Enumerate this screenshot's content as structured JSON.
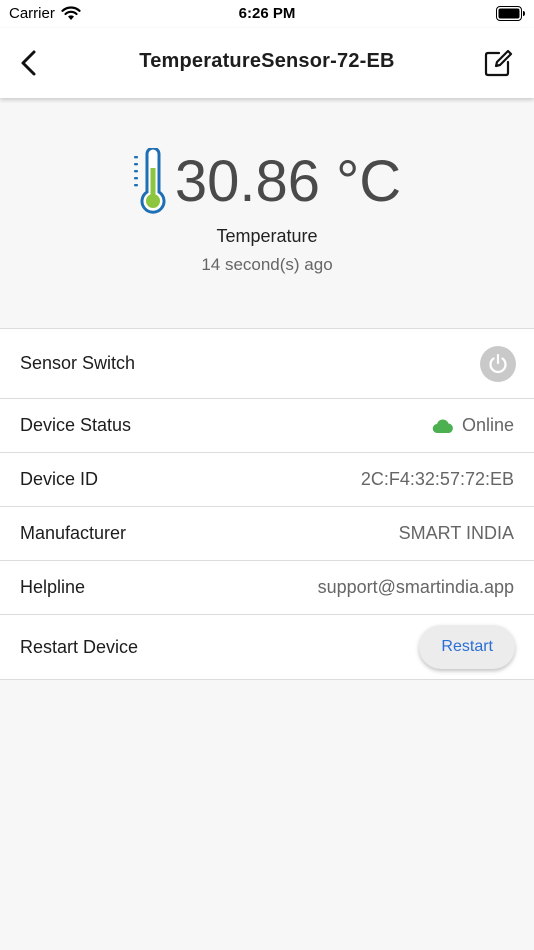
{
  "status_bar": {
    "carrier": "Carrier",
    "time": "6:26 PM"
  },
  "nav": {
    "title": "TemperatureSensor-72-EB",
    "back_icon": "chevron-left-icon",
    "edit_icon": "edit-icon"
  },
  "reading": {
    "value": "30.86 °C",
    "label": "Temperature",
    "updated": "14 second(s) ago",
    "icon": "thermometer-icon"
  },
  "rows": {
    "sensor_switch": {
      "label": "Sensor Switch"
    },
    "device_status": {
      "label": "Device Status",
      "value": "Online"
    },
    "device_id": {
      "label": "Device ID",
      "value": "2C:F4:32:57:72:EB"
    },
    "manufacturer": {
      "label": "Manufacturer",
      "value": "SMART INDIA"
    },
    "helpline": {
      "label": "Helpline",
      "value": "support@smartindia.app"
    },
    "restart": {
      "label": "Restart Device",
      "button": "Restart"
    }
  },
  "colors": {
    "online": "#4caf50",
    "thermo_outline": "#1f6fb5",
    "thermo_fill": "#8cc63f",
    "restart_text": "#2a6fd6"
  }
}
